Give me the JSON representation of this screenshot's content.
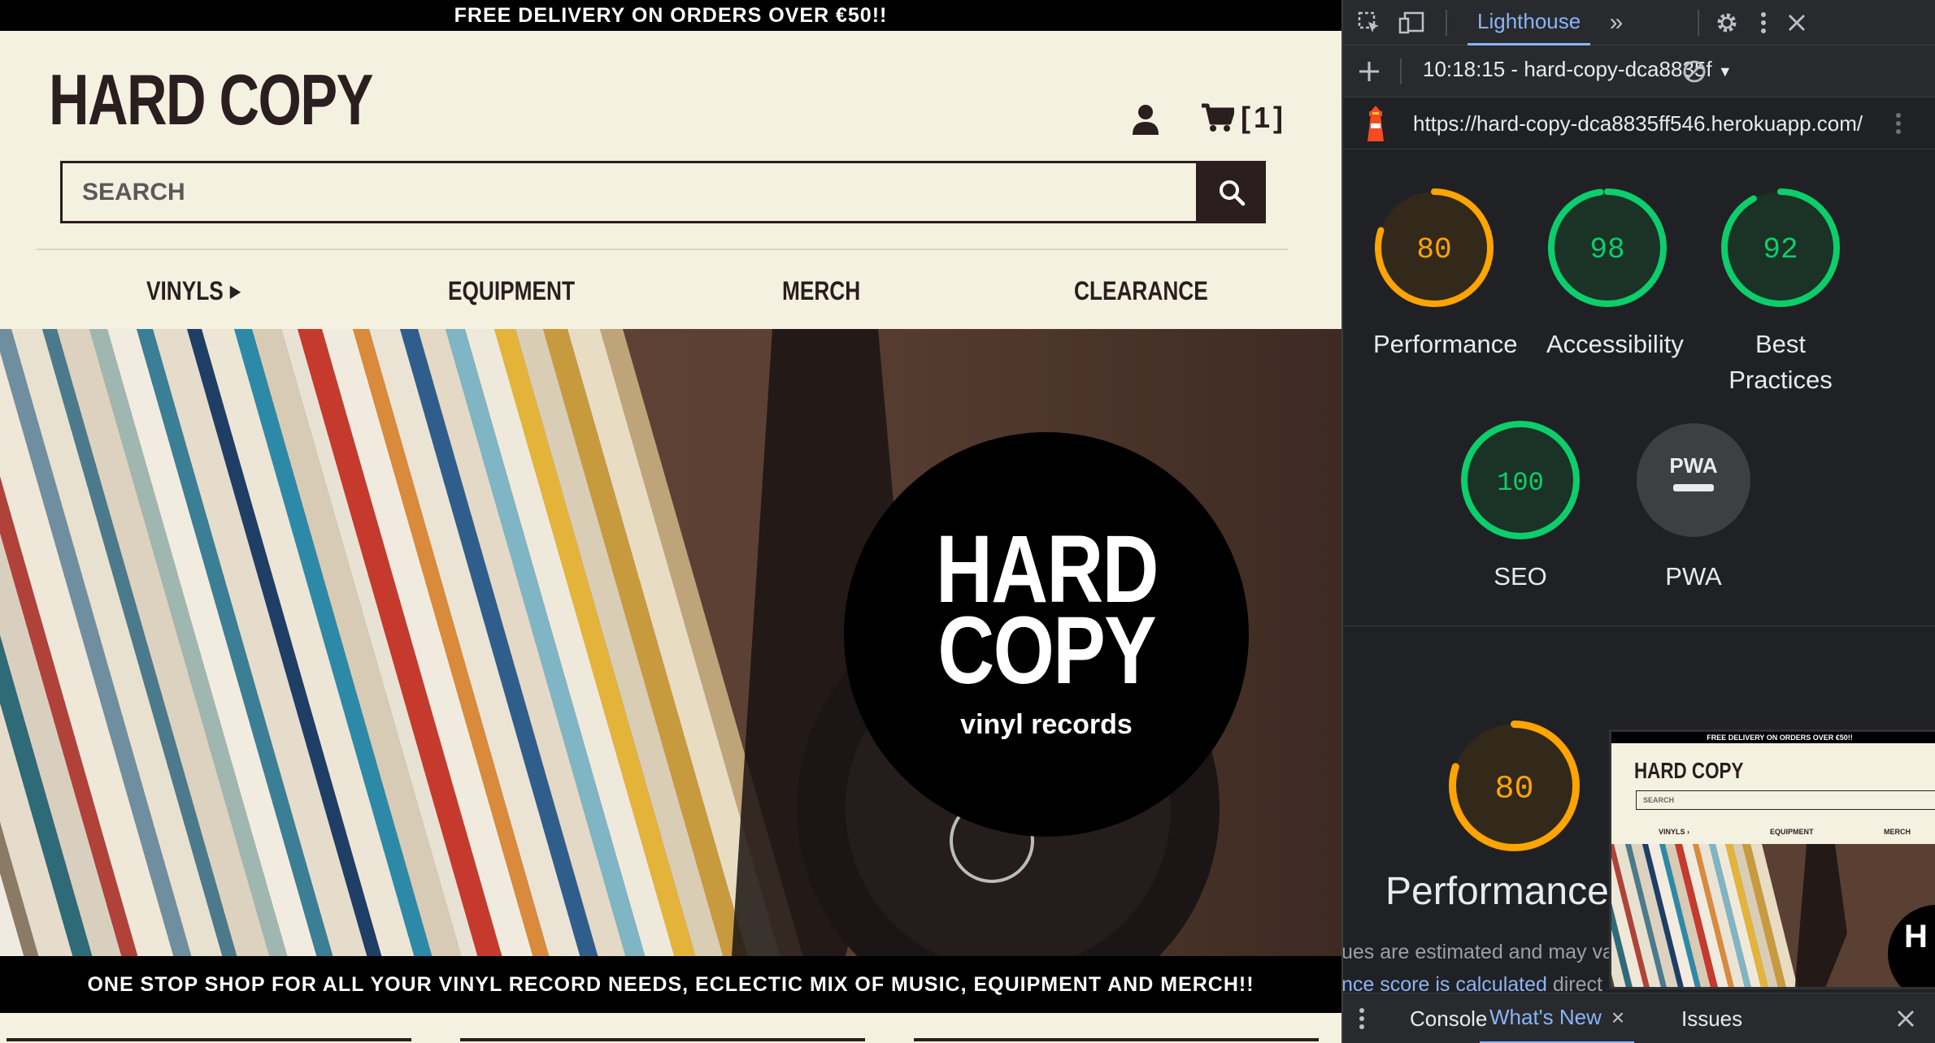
{
  "site": {
    "promo_text": "FREE DELIVERY ON ORDERS OVER €50!!",
    "logo": "HARD COPY",
    "cart_count": "[1]",
    "search_placeholder": "SEARCH",
    "nav": [
      "VINYLS",
      "EQUIPMENT",
      "MERCH",
      "CLEARANCE"
    ],
    "hero_badge": {
      "line1": "HARD",
      "line2": "COPY",
      "sub": "vinyl records"
    },
    "tagline": "ONE STOP SHOP FOR ALL YOUR VINYL RECORD NEEDS, ECLECTIC MIX OF MUSIC, EQUIPMENT AND MERCH!!"
  },
  "devtools": {
    "active_tab": "Lighthouse",
    "report_select": "10:18:15 - hard-copy-dca8835f",
    "url": "https://hard-copy-dca8835ff546.herokuapp.com/",
    "scores": [
      {
        "value": "80",
        "label": "Performance",
        "color": "#ffa400",
        "fraction": 0.8
      },
      {
        "value": "98",
        "label": "Accessibility",
        "color": "#0cce6b",
        "fraction": 0.98
      },
      {
        "value": "92",
        "label": "Best Practices",
        "color": "#0cce6b",
        "fraction": 0.92
      },
      {
        "value": "100",
        "label": "SEO",
        "color": "#0cce6b",
        "fraction": 1.0
      },
      {
        "value": "PWA",
        "label": "PWA",
        "color": "#9aa0a6",
        "fraction": 0
      }
    ],
    "perf_big_score": "80",
    "perf_title": "Performance",
    "perf_note1": "ues are estimated and may va",
    "perf_note2_link": "nce score is calculated",
    "perf_note2_rest": " direct",
    "thumb": {
      "promo": "FREE DELIVERY ON ORDERS OVER €50!!",
      "logo": "HARD COPY",
      "search": "SEARCH",
      "nav": [
        "VINYLS ›",
        "EQUIPMENT",
        "MERCH"
      ],
      "badge": "H C"
    },
    "drawer_tabs": [
      "Console",
      "What's New",
      "Issues"
    ]
  },
  "colors": {
    "site_bg": "#f5f1e1",
    "brand_dark": "#2b1e1e",
    "dt_bg": "#202124",
    "dt_accent": "#8ab4f8",
    "score_green": "#0cce6b",
    "score_orange": "#ffa400"
  }
}
